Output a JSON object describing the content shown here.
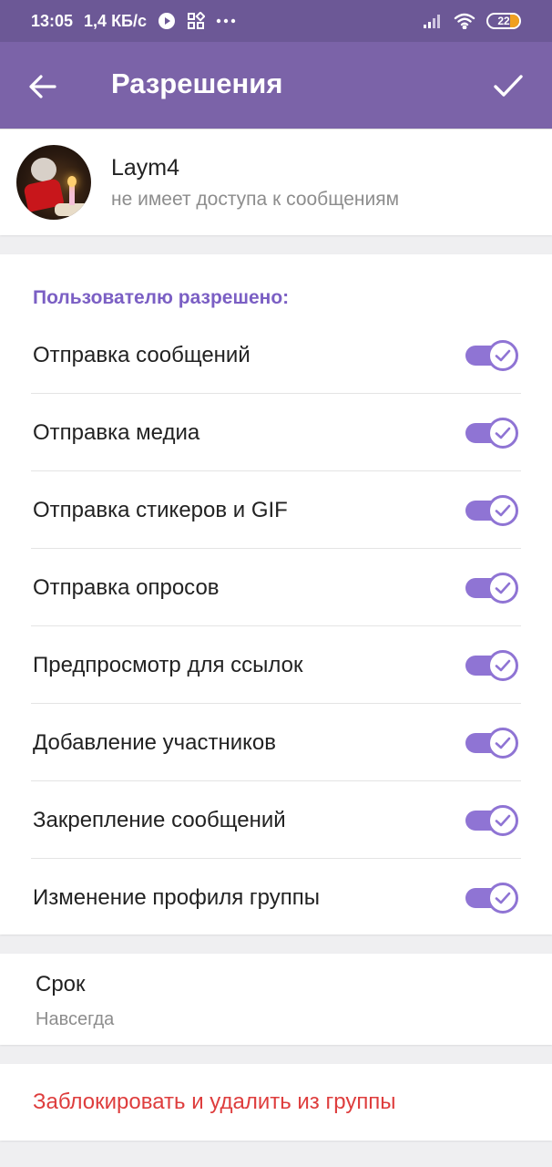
{
  "status_bar": {
    "time": "13:05",
    "speed": "1,4 КБ/с",
    "battery": "22",
    "icons": [
      "play-icon",
      "grid-icon",
      "more-dots-icon",
      "signal-icon",
      "wifi-icon",
      "battery-icon"
    ]
  },
  "app_bar": {
    "title": "Разрешения",
    "back_icon": "arrow-left-icon",
    "confirm_icon": "check-icon"
  },
  "user": {
    "name": "Laym4",
    "status": "не имеет доступа к сообщениям"
  },
  "permissions": {
    "header": "Пользователю разрешено:",
    "items": [
      {
        "label": "Отправка сообщений",
        "enabled": true
      },
      {
        "label": "Отправка медиа",
        "enabled": true
      },
      {
        "label": "Отправка стикеров и GIF",
        "enabled": true
      },
      {
        "label": "Отправка опросов",
        "enabled": true
      },
      {
        "label": "Предпросмотр для ссылок",
        "enabled": true
      },
      {
        "label": "Добавление участников",
        "enabled": true
      },
      {
        "label": "Закрепление сообщений",
        "enabled": true
      },
      {
        "label": "Изменение профиля группы",
        "enabled": true
      }
    ]
  },
  "term": {
    "title": "Срок",
    "value": "Навсегда"
  },
  "ban": {
    "label": "Заблокировать и удалить из группы"
  },
  "colors": {
    "status_bar": "#6c5896",
    "app_bar": "#7b63a8",
    "accent": "#8f74d4",
    "header_text": "#7b5fc4",
    "danger": "#de3d3d"
  }
}
